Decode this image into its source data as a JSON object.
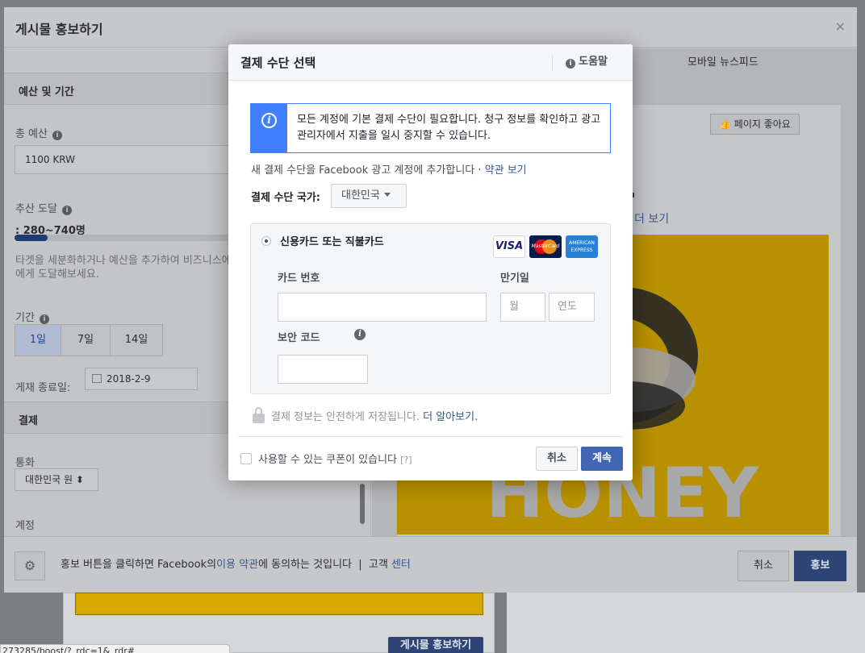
{
  "background_page": {
    "boost_post_label": "게시물 홍보하기",
    "status_url": "273285/boost/?_rdc=1&_rdr#"
  },
  "outer_dialog": {
    "title": "게시물 홍보하기",
    "close_glyph": "×",
    "budget_section": "예산 및 기간",
    "total_budget_label": "총 예산",
    "total_budget_value": "1100 KRW",
    "reach_label": "추산 도달",
    "reach_value": ": 280~740명",
    "reach_fraction": 0.15,
    "reach_hint": "타겟을 세분화하거나 예산을 추가하여 비즈니스에 에게 도달해보세요.",
    "duration_label": "기간",
    "durations": [
      "1일",
      "7일",
      "14일"
    ],
    "selected_duration": "1일",
    "end_date_label": "게재 종료일:",
    "end_date_value": "2018-2-9",
    "payment_section": "결제",
    "currency_label": "통화",
    "currency_value": "대한민국 원",
    "account_label": "계정",
    "mobile_tab": "모바일 뉴스피드",
    "like_page": "페이지 좋아요",
    "see_more_fragment": "더 보기",
    "honey_text": "HONEY",
    "footer_text_1": "홍보 버튼을 클릭하면 Facebook의",
    "footer_terms": "이용 약관",
    "footer_text_2": "에 동의하는 것입니다",
    "footer_separator": "|",
    "footer_help_a": "고객",
    "footer_help_b": "센터",
    "cancel": "취소",
    "boost": "홍보"
  },
  "modal": {
    "title": "결제 수단 선택",
    "help": "도움말",
    "notice": "모든 계정에 기본 결제 수단이 필요합니다. 청구 정보를 확인하고 광고 관리자에서 지출을 일시 중지할 수 있습니다.",
    "add_text": "새 결제 수단을 Facebook 광고 계정에 추가합니다 ·",
    "terms_link": "약관 보기",
    "country_label": "결제 수단 국가:",
    "country_value": "대한민국",
    "card_option": "신용카드 또는 직불카드",
    "card_number_label": "카드 번호",
    "expiry_label": "만기일",
    "month_placeholder": "월",
    "year_placeholder": "연도",
    "security_code_label": "보안 코드",
    "secure_text": "결제 정보는 안전하게 저장됩니다.",
    "learn_more": "더 알아보기",
    "learn_more_period": ".",
    "coupon_text": "사용할 수 있는 쿠폰이 있습니다",
    "coupon_help": "[?]",
    "cancel": "취소",
    "continue": "계속",
    "card_brands": {
      "visa": "VISA",
      "mastercard": "MasterCard",
      "amex": "AMERICAN EXPRESS"
    }
  },
  "icons": {
    "info": "i",
    "gear": "⚙",
    "calendar": "calendar-icon",
    "lock": "lock-icon",
    "thumbs_up": "👍"
  },
  "colors": {
    "facebook_blue": "#4267b2",
    "notice_blue": "#4080ff",
    "link_blue": "#365899",
    "honey_yellow": "#d5a900"
  }
}
